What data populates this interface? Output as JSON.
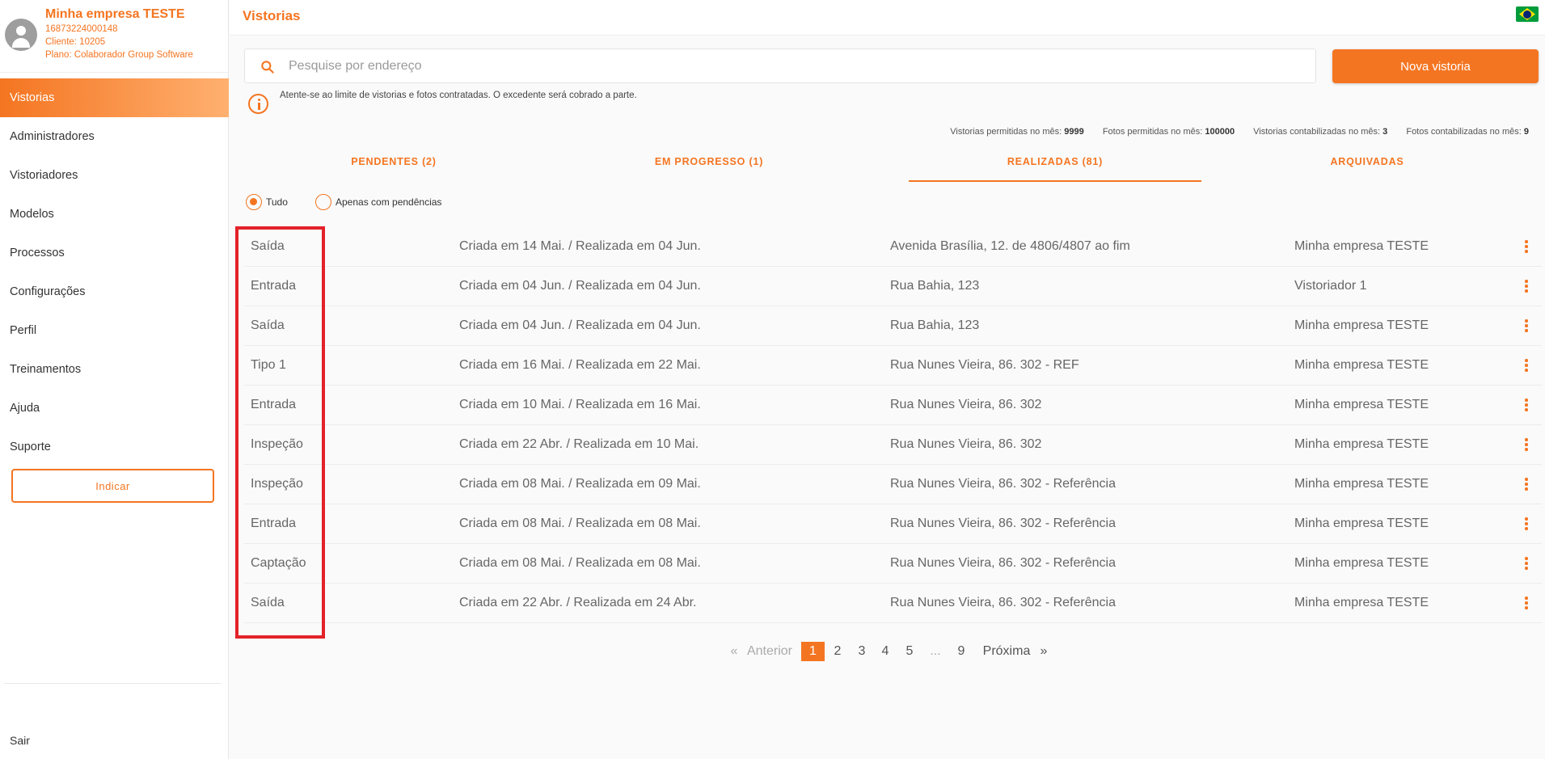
{
  "profile": {
    "company": "Minha empresa TESTE",
    "cnpj": "16873224000148",
    "client": "Cliente: 10205",
    "plan": "Plano: Colaborador Group Software"
  },
  "sidebar": {
    "items": [
      {
        "label": "Vistorias",
        "active": true
      },
      {
        "label": "Administradores"
      },
      {
        "label": "Vistoriadores"
      },
      {
        "label": "Modelos"
      },
      {
        "label": "Processos"
      },
      {
        "label": "Configurações"
      },
      {
        "label": "Perfil"
      },
      {
        "label": "Treinamentos"
      },
      {
        "label": "Ajuda"
      },
      {
        "label": "Suporte"
      }
    ],
    "indicar_label": "Indicar",
    "sair_label": "Sair"
  },
  "header": {
    "title": "Vistorias",
    "flag_icon": "brazil-flag-icon"
  },
  "search": {
    "placeholder": "Pesquise por endereço",
    "value": ""
  },
  "actions": {
    "nova_vistoria": "Nova vistoria"
  },
  "info": {
    "text": "Atente-se ao limite de vistorias e fotos contratadas. O excedente será cobrado a parte."
  },
  "stats": {
    "vistorias_permitidas_label": "Vistorias permitidas no mês:",
    "vistorias_permitidas_value": "9999",
    "fotos_permitidas_label": "Fotos permitidas no mês:",
    "fotos_permitidas_value": "100000",
    "vistorias_contabilizadas_label": "Vistorias contabilizadas no mês:",
    "vistorias_contabilizadas_value": "3",
    "fotos_contabilizadas_label": "Fotos contabilizadas no mês:",
    "fotos_contabilizadas_value": "9"
  },
  "tabs": [
    {
      "label": "PENDENTES (2)"
    },
    {
      "label": "EM PROGRESSO (1)"
    },
    {
      "label": "REALIZADAS (81)",
      "active": true
    },
    {
      "label": "ARQUIVADAS"
    }
  ],
  "filters": {
    "all": "Tudo",
    "pending_only": "Apenas com pendências",
    "selected": "Tudo"
  },
  "rows": [
    {
      "type": "Saída",
      "dates": "Criada em 14 Mai. / Realizada em 04 Jun.",
      "address": "Avenida Brasília, 12. de 4806/4807 ao fim",
      "owner": "Minha empresa TESTE"
    },
    {
      "type": "Entrada",
      "dates": "Criada em 04 Jun. / Realizada em 04 Jun.",
      "address": "Rua Bahia, 123",
      "owner": "Vistoriador 1"
    },
    {
      "type": "Saída",
      "dates": "Criada em 04 Jun. / Realizada em 04 Jun.",
      "address": "Rua Bahia, 123",
      "owner": "Minha empresa TESTE"
    },
    {
      "type": "Tipo 1",
      "dates": "Criada em 16 Mai. / Realizada em 22 Mai.",
      "address": "Rua Nunes Vieira, 86. 302 - REF",
      "owner": "Minha empresa TESTE"
    },
    {
      "type": "Entrada",
      "dates": "Criada em 10 Mai. / Realizada em 16 Mai.",
      "address": "Rua Nunes Vieira, 86. 302",
      "owner": "Minha empresa TESTE"
    },
    {
      "type": "Inspeção",
      "dates": "Criada em 22 Abr. / Realizada em 10 Mai.",
      "address": "Rua Nunes Vieira, 86. 302",
      "owner": "Minha empresa TESTE"
    },
    {
      "type": "Inspeção",
      "dates": "Criada em 08 Mai. / Realizada em 09 Mai.",
      "address": "Rua Nunes Vieira, 86. 302 - Referência",
      "owner": "Minha empresa TESTE"
    },
    {
      "type": "Entrada",
      "dates": "Criada em 08 Mai. / Realizada em 08 Mai.",
      "address": "Rua Nunes Vieira, 86. 302 - Referência",
      "owner": "Minha empresa TESTE"
    },
    {
      "type": "Captação",
      "dates": "Criada em 08 Mai. / Realizada em 08 Mai.",
      "address": "Rua Nunes Vieira, 86. 302 - Referência",
      "owner": "Minha empresa TESTE"
    },
    {
      "type": "Saída",
      "dates": "Criada em 22 Abr. / Realizada em 24 Abr.",
      "address": "Rua Nunes Vieira, 86. 302 - Referência",
      "owner": "Minha empresa TESTE"
    }
  ],
  "pagination": {
    "prev_arrow": "«",
    "prev": "Anterior",
    "pages": [
      "1",
      "2",
      "3",
      "4",
      "5",
      "...",
      "9"
    ],
    "current": "1",
    "next": "Próxima",
    "next_arrow": "»"
  },
  "colors": {
    "accent": "#f47521",
    "highlight": "#e32229"
  }
}
